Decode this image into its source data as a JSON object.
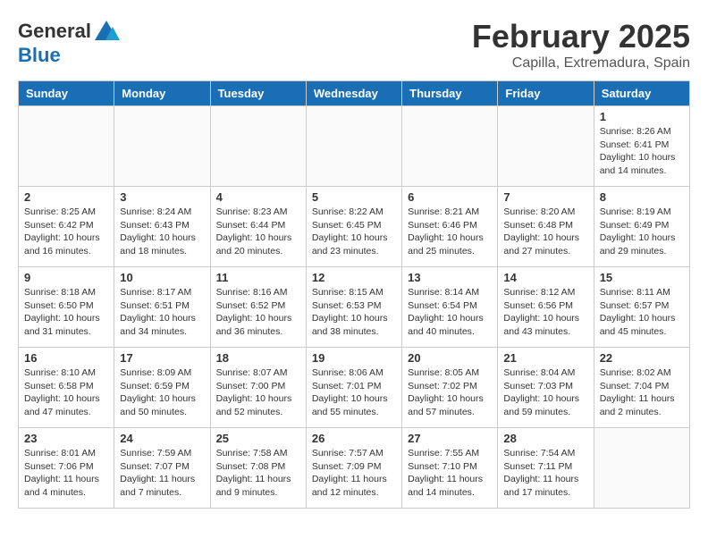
{
  "header": {
    "logo_general": "General",
    "logo_blue": "Blue",
    "month": "February 2025",
    "location": "Capilla, Extremadura, Spain"
  },
  "days_of_week": [
    "Sunday",
    "Monday",
    "Tuesday",
    "Wednesday",
    "Thursday",
    "Friday",
    "Saturday"
  ],
  "weeks": [
    [
      {
        "day": "",
        "info": ""
      },
      {
        "day": "",
        "info": ""
      },
      {
        "day": "",
        "info": ""
      },
      {
        "day": "",
        "info": ""
      },
      {
        "day": "",
        "info": ""
      },
      {
        "day": "",
        "info": ""
      },
      {
        "day": "1",
        "info": "Sunrise: 8:26 AM\nSunset: 6:41 PM\nDaylight: 10 hours and 14 minutes."
      }
    ],
    [
      {
        "day": "2",
        "info": "Sunrise: 8:25 AM\nSunset: 6:42 PM\nDaylight: 10 hours and 16 minutes."
      },
      {
        "day": "3",
        "info": "Sunrise: 8:24 AM\nSunset: 6:43 PM\nDaylight: 10 hours and 18 minutes."
      },
      {
        "day": "4",
        "info": "Sunrise: 8:23 AM\nSunset: 6:44 PM\nDaylight: 10 hours and 20 minutes."
      },
      {
        "day": "5",
        "info": "Sunrise: 8:22 AM\nSunset: 6:45 PM\nDaylight: 10 hours and 23 minutes."
      },
      {
        "day": "6",
        "info": "Sunrise: 8:21 AM\nSunset: 6:46 PM\nDaylight: 10 hours and 25 minutes."
      },
      {
        "day": "7",
        "info": "Sunrise: 8:20 AM\nSunset: 6:48 PM\nDaylight: 10 hours and 27 minutes."
      },
      {
        "day": "8",
        "info": "Sunrise: 8:19 AM\nSunset: 6:49 PM\nDaylight: 10 hours and 29 minutes."
      }
    ],
    [
      {
        "day": "9",
        "info": "Sunrise: 8:18 AM\nSunset: 6:50 PM\nDaylight: 10 hours and 31 minutes."
      },
      {
        "day": "10",
        "info": "Sunrise: 8:17 AM\nSunset: 6:51 PM\nDaylight: 10 hours and 34 minutes."
      },
      {
        "day": "11",
        "info": "Sunrise: 8:16 AM\nSunset: 6:52 PM\nDaylight: 10 hours and 36 minutes."
      },
      {
        "day": "12",
        "info": "Sunrise: 8:15 AM\nSunset: 6:53 PM\nDaylight: 10 hours and 38 minutes."
      },
      {
        "day": "13",
        "info": "Sunrise: 8:14 AM\nSunset: 6:54 PM\nDaylight: 10 hours and 40 minutes."
      },
      {
        "day": "14",
        "info": "Sunrise: 8:12 AM\nSunset: 6:56 PM\nDaylight: 10 hours and 43 minutes."
      },
      {
        "day": "15",
        "info": "Sunrise: 8:11 AM\nSunset: 6:57 PM\nDaylight: 10 hours and 45 minutes."
      }
    ],
    [
      {
        "day": "16",
        "info": "Sunrise: 8:10 AM\nSunset: 6:58 PM\nDaylight: 10 hours and 47 minutes."
      },
      {
        "day": "17",
        "info": "Sunrise: 8:09 AM\nSunset: 6:59 PM\nDaylight: 10 hours and 50 minutes."
      },
      {
        "day": "18",
        "info": "Sunrise: 8:07 AM\nSunset: 7:00 PM\nDaylight: 10 hours and 52 minutes."
      },
      {
        "day": "19",
        "info": "Sunrise: 8:06 AM\nSunset: 7:01 PM\nDaylight: 10 hours and 55 minutes."
      },
      {
        "day": "20",
        "info": "Sunrise: 8:05 AM\nSunset: 7:02 PM\nDaylight: 10 hours and 57 minutes."
      },
      {
        "day": "21",
        "info": "Sunrise: 8:04 AM\nSunset: 7:03 PM\nDaylight: 10 hours and 59 minutes."
      },
      {
        "day": "22",
        "info": "Sunrise: 8:02 AM\nSunset: 7:04 PM\nDaylight: 11 hours and 2 minutes."
      }
    ],
    [
      {
        "day": "23",
        "info": "Sunrise: 8:01 AM\nSunset: 7:06 PM\nDaylight: 11 hours and 4 minutes."
      },
      {
        "day": "24",
        "info": "Sunrise: 7:59 AM\nSunset: 7:07 PM\nDaylight: 11 hours and 7 minutes."
      },
      {
        "day": "25",
        "info": "Sunrise: 7:58 AM\nSunset: 7:08 PM\nDaylight: 11 hours and 9 minutes."
      },
      {
        "day": "26",
        "info": "Sunrise: 7:57 AM\nSunset: 7:09 PM\nDaylight: 11 hours and 12 minutes."
      },
      {
        "day": "27",
        "info": "Sunrise: 7:55 AM\nSunset: 7:10 PM\nDaylight: 11 hours and 14 minutes."
      },
      {
        "day": "28",
        "info": "Sunrise: 7:54 AM\nSunset: 7:11 PM\nDaylight: 11 hours and 17 minutes."
      },
      {
        "day": "",
        "info": ""
      }
    ]
  ]
}
